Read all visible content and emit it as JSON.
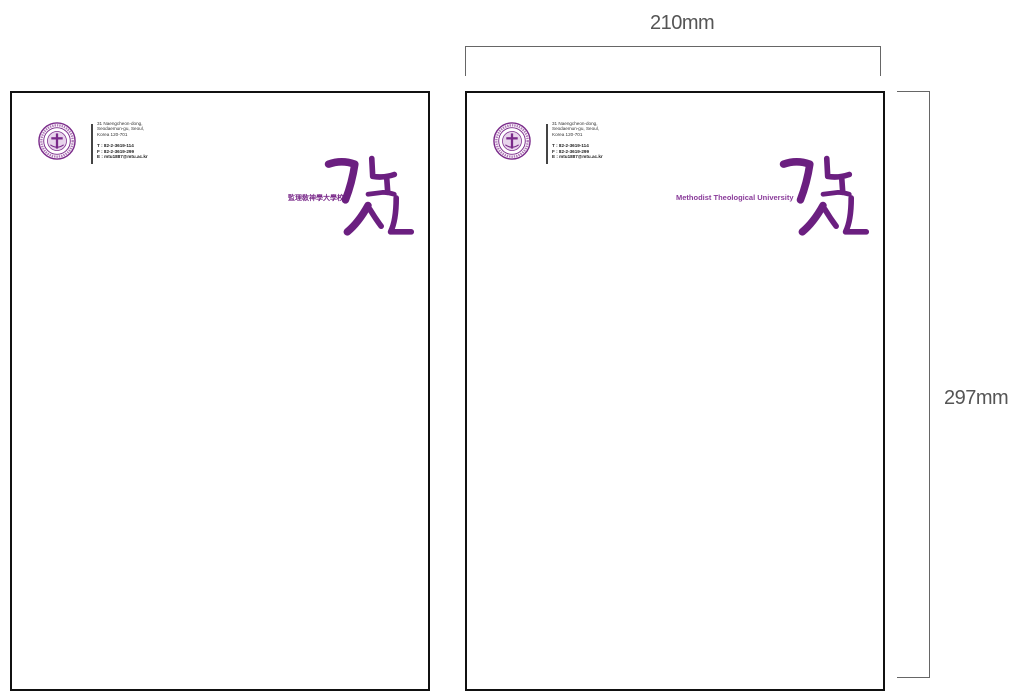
{
  "dimensions": {
    "width_label": "210mm",
    "height_label": "297mm"
  },
  "letterhead": {
    "address_lines": [
      "31 Naengcheon-dong,",
      "Seodaemun-gu, Seoul,",
      "Korea 120-701"
    ],
    "contact_lines": [
      "T : 82-2-3619-114",
      "F : 82-2-3619-299",
      "E : mtu1887@mtu.ac.kr"
    ]
  },
  "sheets": [
    {
      "institution_name": "監理敎神學大學校"
    },
    {
      "institution_name": "Methodist Theological University"
    }
  ],
  "colors": {
    "brand_purple": "#7a2a8a",
    "frame": "#111111",
    "dimension_line": "#666666"
  }
}
